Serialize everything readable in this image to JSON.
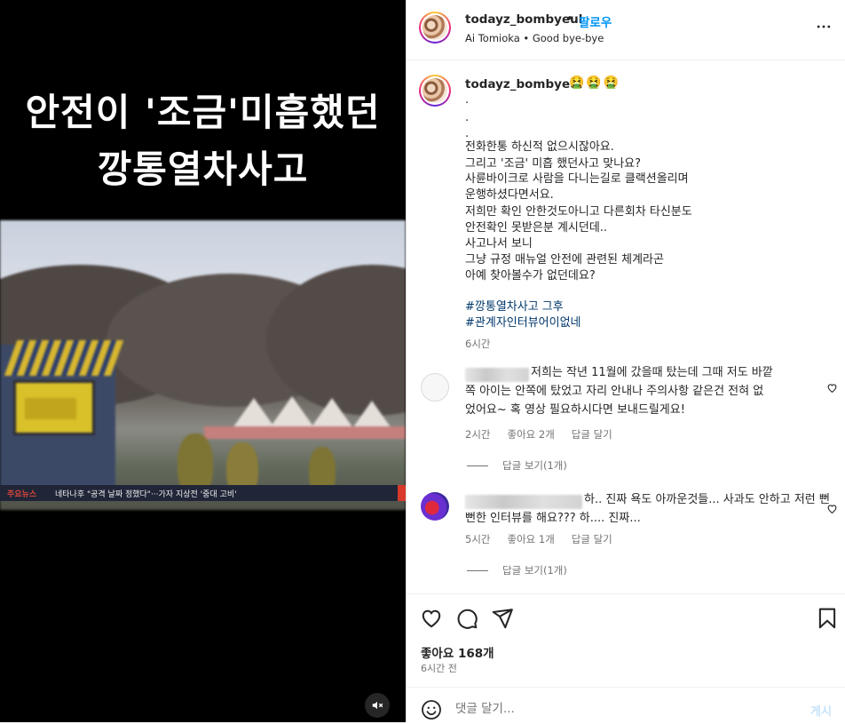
{
  "media": {
    "headline_line1": "안전이 '조금'미흡했던",
    "headline_line2": "깡통열차사고",
    "ticker_label": "주요뉴스",
    "ticker_text": "네타나후 \"공격 날짜 정했다\"···가자 지상전 '중대 고비'",
    "sign_text": "",
    "mute_icon": "muted-speaker-icon"
  },
  "post_header": {
    "username": "todayz_bombyeul",
    "separator": "•",
    "follow_label": "팔로우",
    "subtitle": "Ai Tomioka • Good bye-bye",
    "more_icon": "more-options-icon"
  },
  "caption": {
    "username": "todayz_bombyeul",
    "emojis": "🤮🤮🤮",
    "lines": [
      ".",
      ".",
      ".",
      "전화한통 하신적 없으시잖아요.",
      "그리고 '조금' 미흡 했던사고 맞나요?",
      "사륜바이크로 사람을 다니는길로 클랙션올리며",
      "운행하셨다면서요.",
      "저희만 확인 안한것도아니고 다른회차 타신분도",
      "안전확인 못받은분 계시던데..",
      "사고나서 보니",
      "그냥 규정 매뉴얼 안전에 관련된 체계라곤",
      "아예 찾아볼수가 없던데요?"
    ],
    "hashtags": [
      "#깡통열차사고 그후",
      "#관계자인터뷰어이없네"
    ],
    "time": "6시간"
  },
  "comments": [
    {
      "lines": [
        "저희는 작년 11월에 갔을때 탔는데 그때 저도 바깥",
        "쪽 아이는 안쪽에 탔었고 자리 안내나 주의사항 같은건 전혀 없",
        "었어요~ 혹 영상 필요하시다면 보내드릴게요!"
      ],
      "time": "2시간",
      "likes": "좋아요 2개",
      "reply": "답글 달기",
      "view_replies": "답글 보기(1개)"
    },
    {
      "lines": [
        "하.. 진짜 욕도 아까운것들... 사과도 안하고 저런 뻔",
        "뻔한 인터뷰를 해요??? 하.... 진짜..."
      ],
      "time": "5시간",
      "likes": "좋아요 1개",
      "reply": "답글 달기",
      "view_replies": "답글 보기(1개)"
    }
  ],
  "actions": {
    "icons": [
      "heart-icon",
      "comment-icon",
      "share-icon",
      "bookmark-icon"
    ],
    "likes": "좋아요 168개",
    "posted": "6시간 전"
  },
  "comment_box": {
    "placeholder": "댓글 달기...",
    "post_label": "게시"
  },
  "colors": {
    "accent": "#0095f6",
    "hashtag": "#00376b",
    "muted": "#737373"
  }
}
